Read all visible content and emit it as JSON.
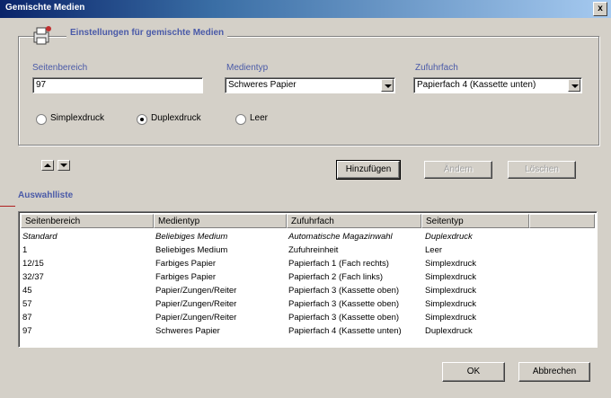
{
  "window": {
    "title": "Gemischte Medien",
    "close": "x"
  },
  "group": {
    "title": "Einstellungen für gemischte Medien"
  },
  "fields": {
    "seitenbereich": {
      "label": "Seitenbereich",
      "value": "97"
    },
    "medientyp": {
      "label": "Medientyp",
      "value": "Schweres Papier"
    },
    "zufuhrfach": {
      "label": "Zufuhrfach",
      "value": "Papierfach 4 (Kassette unten)"
    }
  },
  "radios": [
    {
      "label": "Simplexdruck",
      "checked": false
    },
    {
      "label": "Duplexdruck",
      "checked": true
    },
    {
      "label": "Leer",
      "checked": false
    }
  ],
  "buttons": {
    "hinzufuegen": "Hinzufügen",
    "aendern": "Ändern",
    "loeschen": "Löschen",
    "ok": "OK",
    "abbrechen": "Abbrechen"
  },
  "list": {
    "label": "Auswahlliste",
    "columns": [
      "Seitenbereich",
      "Medientyp",
      "Zufuhrfach",
      "Seitentyp"
    ],
    "rows": [
      {
        "c": [
          "Standard",
          "Beliebiges Medium",
          "Automatische Magazinwahl",
          "Duplexdruck"
        ],
        "italic": true
      },
      {
        "c": [
          "1",
          "Beliebiges Medium",
          "Zufuhreinheit",
          "Leer"
        ],
        "italic": false
      },
      {
        "c": [
          "12/15",
          "Farbiges Papier",
          "Papierfach 1 (Fach rechts)",
          "Simplexdruck"
        ],
        "italic": false
      },
      {
        "c": [
          "32/37",
          "Farbiges Papier",
          "Papierfach 2 (Fach links)",
          "Simplexdruck"
        ],
        "italic": false
      },
      {
        "c": [
          "45",
          "Papier/Zungen/Reiter",
          "Papierfach 3 (Kassette oben)",
          "Simplexdruck"
        ],
        "italic": false
      },
      {
        "c": [
          "57",
          "Papier/Zungen/Reiter",
          "Papierfach 3 (Kassette oben)",
          "Simplexdruck"
        ],
        "italic": false
      },
      {
        "c": [
          "87",
          "Papier/Zungen/Reiter",
          "Papierfach 3 (Kassette oben)",
          "Simplexdruck"
        ],
        "italic": false
      },
      {
        "c": [
          "97",
          "Schweres Papier",
          "Papierfach 4 (Kassette unten)",
          "Duplexdruck"
        ],
        "italic": false
      }
    ]
  }
}
